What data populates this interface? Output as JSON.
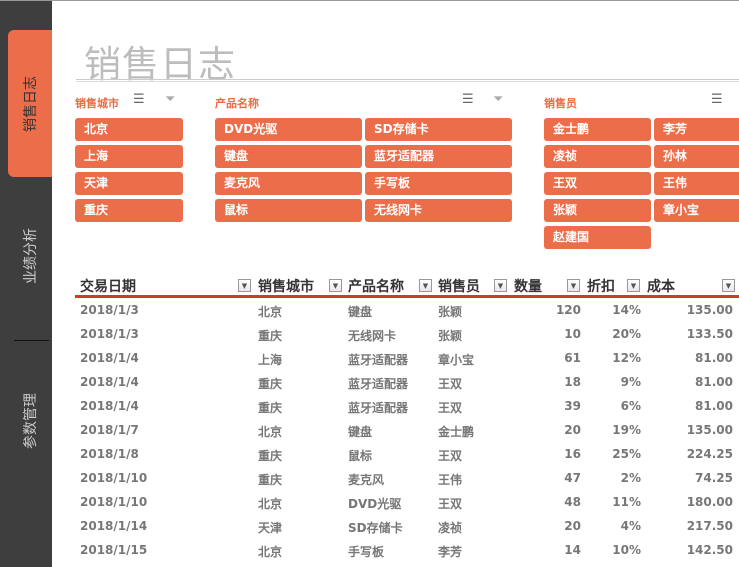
{
  "nav": {
    "items": [
      {
        "label": "销售日志",
        "active": true
      },
      {
        "label": "业绩分析"
      },
      {
        "label": "参数管理"
      }
    ]
  },
  "title": "销售日志",
  "icons": {
    "multiselect": "multi-select-icon",
    "clear": "clear-filter-icon"
  },
  "colors": {
    "accent": "#ec6d4a",
    "sidebar": "#3e3e3e",
    "header_line": "#c8411e"
  },
  "slicers": {
    "city": {
      "label": "销售城市",
      "items": [
        "北京",
        "上海",
        "天津",
        "重庆"
      ]
    },
    "product": {
      "label": "产品名称",
      "items": [
        "DVD光驱",
        "键盘",
        "麦克风",
        "鼠标",
        "SD存储卡",
        "蓝牙适配器",
        "手写板",
        "无线网卡"
      ]
    },
    "salesperson": {
      "label": "销售员",
      "items": [
        "金士鹏",
        "凌祯",
        "王双",
        "张颖",
        "赵建国",
        "李芳",
        "孙林",
        "王伟",
        "章小宝"
      ]
    }
  },
  "table": {
    "columns": [
      "交易日期",
      "销售城市",
      "产品名称",
      "销售员",
      "数量",
      "折扣",
      "成本"
    ],
    "rows": [
      [
        "2018/1/3",
        "北京",
        "键盘",
        "张颖",
        "120",
        "14%",
        "135.00"
      ],
      [
        "2018/1/3",
        "重庆",
        "无线网卡",
        "张颖",
        "10",
        "20%",
        "133.50"
      ],
      [
        "2018/1/4",
        "上海",
        "蓝牙适配器",
        "章小宝",
        "61",
        "12%",
        "81.00"
      ],
      [
        "2018/1/4",
        "重庆",
        "蓝牙适配器",
        "王双",
        "18",
        "9%",
        "81.00"
      ],
      [
        "2018/1/4",
        "重庆",
        "蓝牙适配器",
        "王双",
        "39",
        "6%",
        "81.00"
      ],
      [
        "2018/1/7",
        "北京",
        "键盘",
        "金士鹏",
        "20",
        "19%",
        "135.00"
      ],
      [
        "2018/1/8",
        "重庆",
        "鼠标",
        "王双",
        "16",
        "25%",
        "224.25"
      ],
      [
        "2018/1/10",
        "重庆",
        "麦克风",
        "王伟",
        "47",
        "2%",
        "74.25"
      ],
      [
        "2018/1/10",
        "北京",
        "DVD光驱",
        "王双",
        "48",
        "11%",
        "180.00"
      ],
      [
        "2018/1/14",
        "天津",
        "SD存储卡",
        "凌祯",
        "20",
        "4%",
        "217.50"
      ],
      [
        "2018/1/15",
        "北京",
        "手写板",
        "李芳",
        "14",
        "10%",
        "142.50"
      ]
    ]
  }
}
